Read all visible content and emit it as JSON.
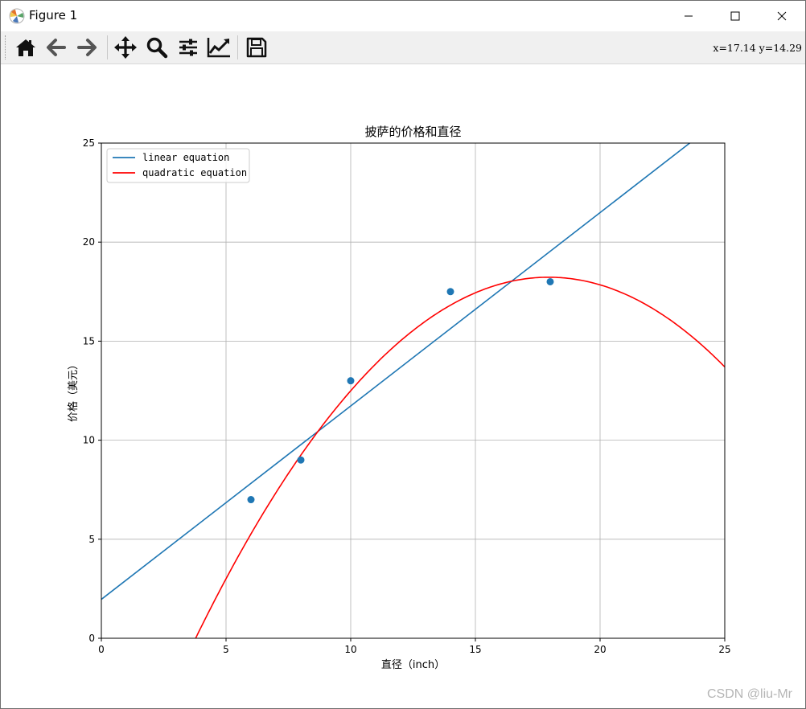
{
  "window": {
    "title": "Figure 1"
  },
  "toolbar": {
    "buttons": [
      {
        "name": "home-icon"
      },
      {
        "name": "back-arrow-icon"
      },
      {
        "name": "forward-arrow-icon"
      },
      {
        "name": "pan-move-icon"
      },
      {
        "name": "zoom-magnifier-icon"
      },
      {
        "name": "configure-subplots-icon"
      },
      {
        "name": "edit-axis-icon"
      },
      {
        "name": "save-floppy-icon"
      }
    ],
    "coords": "x=17.14 y=14.29"
  },
  "watermark": "CSDN @liu-Mr",
  "chart_data": {
    "type": "scatter",
    "title": "披萨的价格和直径",
    "xlabel": "直径（inch）",
    "ylabel": "价格（美元）",
    "xlim": [
      0,
      25
    ],
    "ylim": [
      0,
      25
    ],
    "xticks": [
      "0",
      "5",
      "10",
      "15",
      "20",
      "25"
    ],
    "yticks": [
      "0",
      "5",
      "10",
      "15",
      "20",
      "25"
    ],
    "grid": true,
    "legend_position": "upper left",
    "points": {
      "x": [
        6,
        8,
        10,
        14,
        18
      ],
      "y": [
        7,
        9,
        13,
        17.5,
        18
      ],
      "color": "#1f77b4"
    },
    "series": [
      {
        "name": "linear equation",
        "color": "#1f77b4",
        "kind": "linear",
        "intercept": 1.9655,
        "slope": 0.9763
      },
      {
        "name": "quadratic equation",
        "color": "#ff0000",
        "kind": "quadratic",
        "a": -0.0909,
        "b": 3.2617,
        "c": -11.0313,
        "x_from": 3,
        "x_to": 25
      }
    ]
  }
}
